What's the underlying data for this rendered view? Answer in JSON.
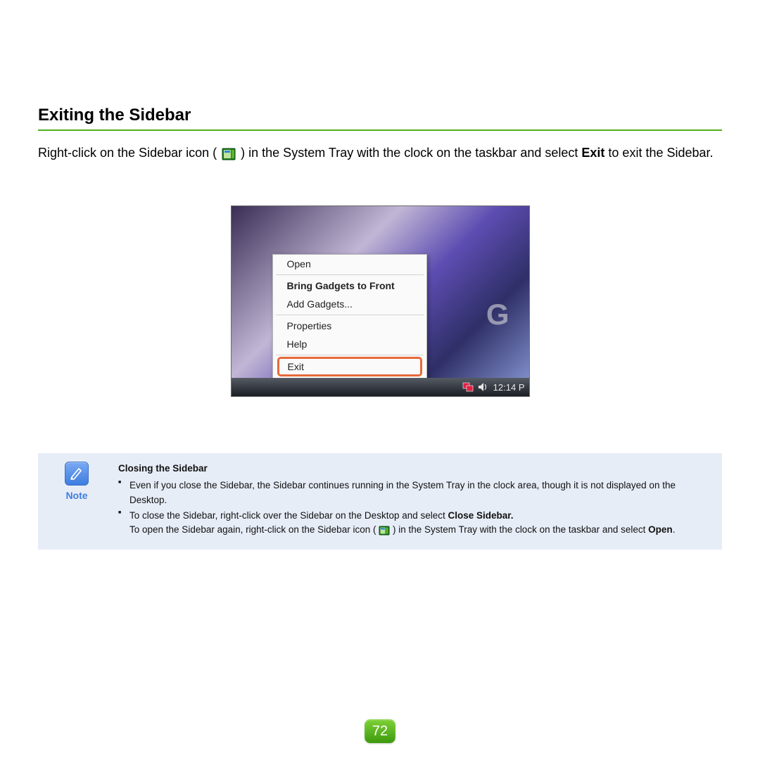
{
  "heading": "Exiting the Sidebar",
  "body": {
    "part1": "Right-click on the Sidebar icon (",
    "part2": ") in the System Tray with the clock on the taskbar and select ",
    "bold1": "Exit",
    "part3": " to exit the Sidebar."
  },
  "screenshot": {
    "desktop_brand_fragment": "G",
    "menu": {
      "open": "Open",
      "bring_front": "Bring Gadgets to Front",
      "add_gadgets": "Add Gadgets...",
      "properties": "Properties",
      "help": "Help",
      "exit": "Exit"
    },
    "taskbar": {
      "clock": "12:14 P"
    }
  },
  "note": {
    "label": "Note",
    "title": "Closing the Sidebar",
    "bullet1": "Even if you close the Sidebar, the Sidebar continues running in the System Tray in the clock area, though it is not displayed on the Desktop.",
    "bullet2_a": "To close the Sidebar, right-click over the Sidebar on the Desktop and select ",
    "bullet2_bold": "Close Sidebar.",
    "bullet2_b": "To open the Sidebar again, right-click on the Sidebar icon (",
    "bullet2_c": ") in the System Tray with the clock on the taskbar and select ",
    "bullet2_open": "Open",
    "bullet2_d": "."
  },
  "page_number": "72"
}
